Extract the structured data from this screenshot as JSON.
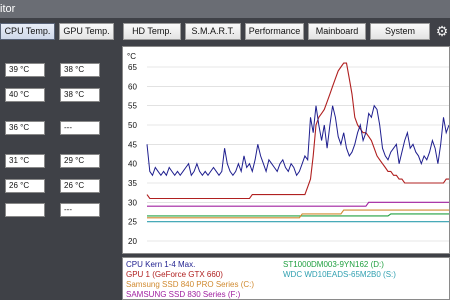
{
  "window": {
    "title": "itor"
  },
  "tabs": [
    {
      "label": "CPU Temp.",
      "active": true
    },
    {
      "label": "GPU Temp.",
      "active": false
    },
    {
      "label": "HD Temp.",
      "active": false
    },
    {
      "label": "S.M.A.R.T.",
      "active": false
    },
    {
      "label": "Performance",
      "active": false
    },
    {
      "label": "Mainboard",
      "active": false
    },
    {
      "label": "System",
      "active": false
    }
  ],
  "values": [
    [
      "39 °C",
      "38 °C"
    ],
    [
      "40 °C",
      "38 °C"
    ],
    [
      "36 °C",
      "---"
    ],
    [
      "31 °C",
      "29 °C"
    ],
    [
      "26 °C",
      "26 °C"
    ],
    [
      "",
      "---"
    ]
  ],
  "chart_data": {
    "type": "line",
    "ylabel": "°C",
    "ylim": [
      20,
      65
    ],
    "yticks": [
      "65",
      "60",
      "55",
      "50",
      "45",
      "40",
      "35",
      "30",
      "25",
      "20"
    ],
    "series": [
      {
        "name": "CPU Kern 1-4 Max.",
        "color": "#1f1f8f",
        "values": [
          45,
          38,
          37,
          39,
          38,
          37,
          38,
          37,
          39,
          38,
          37,
          38,
          37,
          38,
          39,
          40,
          37,
          38,
          40,
          38,
          37,
          38,
          37,
          38,
          39,
          38,
          37,
          38,
          44,
          40,
          38,
          37,
          38,
          40,
          38,
          42,
          39,
          40,
          38,
          41,
          45,
          42,
          40,
          38,
          41,
          40,
          39,
          38,
          40,
          41,
          39,
          38,
          40,
          39,
          37,
          38,
          40,
          42,
          41,
          52,
          48,
          55,
          50,
          46,
          50,
          44,
          50,
          55,
          52,
          47,
          45,
          48,
          44,
          42,
          43,
          45,
          48,
          50,
          46,
          48,
          53,
          52,
          55,
          54,
          50,
          44,
          42,
          41,
          43,
          44,
          45,
          40,
          43,
          46,
          48,
          44,
          45,
          43,
          42,
          40,
          42,
          41,
          43,
          46,
          44,
          40,
          45,
          52,
          48,
          50
        ]
      },
      {
        "name": "GPU 1 (GeForce GTX 660)",
        "color": "#b02020",
        "values": [
          32,
          31,
          31,
          31,
          31,
          31,
          31,
          31,
          31,
          31,
          31,
          31,
          31,
          31,
          31,
          31,
          31,
          31,
          31,
          31,
          31,
          31,
          31,
          31,
          31,
          31,
          31,
          31,
          31,
          31,
          31,
          31,
          31,
          31,
          31,
          31,
          31,
          31,
          32,
          32,
          32,
          32,
          32,
          32,
          32,
          32,
          32,
          32,
          32,
          32,
          32,
          32,
          32,
          32,
          32,
          32,
          32,
          32,
          34,
          36,
          42,
          50,
          52,
          53,
          54,
          56,
          58,
          60,
          62,
          64,
          65,
          66,
          66,
          62,
          58,
          52,
          50,
          49,
          48,
          48,
          47,
          46,
          44,
          42,
          41,
          40,
          39,
          38,
          38,
          37,
          37,
          36,
          36,
          35,
          35,
          35,
          35,
          35,
          35,
          35,
          35,
          35,
          35,
          35,
          35,
          35,
          35,
          35,
          36,
          36
        ]
      },
      {
        "name": "Samsung SSD 840 PRO Series (C:)",
        "color": "#d08a30",
        "values": [
          26,
          26,
          26,
          26,
          26,
          26,
          26,
          26,
          26,
          26,
          26,
          26,
          26,
          26,
          26,
          26,
          26,
          26,
          26,
          26,
          26,
          26,
          26,
          26,
          26,
          26,
          26,
          26,
          26,
          26,
          26,
          26,
          26,
          26,
          26,
          26,
          26,
          26,
          26,
          26,
          26,
          26,
          26,
          26,
          26,
          26,
          26,
          26,
          26,
          26,
          26,
          26,
          26,
          26,
          26,
          26,
          27,
          27,
          27,
          27,
          27,
          27,
          27,
          27,
          27,
          27,
          27,
          27,
          27,
          27,
          27,
          28,
          28,
          28,
          28,
          28,
          28,
          28,
          28,
          28,
          28,
          28,
          28,
          28,
          28,
          28,
          28,
          28,
          28,
          28,
          28,
          28,
          28,
          28,
          28,
          28,
          28,
          28,
          28,
          28,
          28,
          28,
          28,
          28,
          28,
          28,
          28,
          28,
          28,
          28
        ]
      },
      {
        "name": "SAMSUNG SSD 830 Series (F:)",
        "color": "#a020a0",
        "values": [
          29,
          29,
          29,
          29,
          29,
          29,
          29,
          29,
          29,
          29,
          29,
          29,
          29,
          29,
          29,
          29,
          29,
          29,
          29,
          29,
          29,
          29,
          29,
          29,
          29,
          29,
          29,
          29,
          29,
          29,
          29,
          29,
          29,
          29,
          29,
          29,
          29,
          29,
          29,
          29,
          29,
          29,
          29,
          29,
          29,
          29,
          29,
          29,
          29,
          29,
          29,
          29,
          29,
          29,
          29,
          29,
          29,
          29,
          29,
          29,
          29,
          29,
          29,
          29,
          29,
          29,
          29,
          29,
          29,
          29,
          29,
          29,
          29,
          29,
          29,
          29,
          29,
          29,
          29,
          29,
          30,
          30,
          30,
          30,
          30,
          30,
          30,
          30,
          30,
          30,
          30,
          30,
          30,
          30,
          30,
          30,
          30,
          30,
          30,
          30,
          30,
          30,
          30,
          30,
          30,
          30,
          30,
          30,
          30,
          30
        ]
      },
      {
        "name": "ST1000DM003-9YN162 (D:)",
        "color": "#20a040",
        "values": [
          26.5,
          26.5,
          26.5,
          26.5,
          26.5,
          26.5,
          26.5,
          26.5,
          26.5,
          26.5,
          26.5,
          26.5,
          26.5,
          26.5,
          26.5,
          26.5,
          26.5,
          26.5,
          26.5,
          26.5,
          26.5,
          26.5,
          26.5,
          26.5,
          26.5,
          26.5,
          26.5,
          26.5,
          26.5,
          26.5,
          26.5,
          26.5,
          26.5,
          26.5,
          26.5,
          26.5,
          26.5,
          26.5,
          26.5,
          26.5,
          26.5,
          26.5,
          26.5,
          26.5,
          26.5,
          26.5,
          26.5,
          26.5,
          26.5,
          26.5,
          26.5,
          26.5,
          26.5,
          26.5,
          26.5,
          26.5,
          26.5,
          26.5,
          26.5,
          26.5,
          26.5,
          26.5,
          26.5,
          26.5,
          26.5,
          26.5,
          26.5,
          26.5,
          26.5,
          26.5,
          26.5,
          26.5,
          26.5,
          26.5,
          26.5,
          26.5,
          26.5,
          26.5,
          26.5,
          26.5,
          26.5,
          26.5,
          26.5,
          26.5,
          26.5,
          26.5,
          26.5,
          26.5,
          27,
          27,
          27,
          27,
          27,
          27,
          27,
          27,
          27,
          27,
          27,
          27,
          27,
          27,
          27,
          27,
          27,
          27,
          27,
          27,
          27,
          27
        ]
      },
      {
        "name": "WDC WD10EADS-65M2B0 (S:)",
        "color": "#30a0b0",
        "values": [
          25,
          25,
          25,
          25,
          25,
          25,
          25,
          25,
          25,
          25,
          25,
          25,
          25,
          25,
          25,
          25,
          25,
          25,
          25,
          25,
          25,
          25,
          25,
          25,
          25,
          25,
          25,
          25,
          25,
          25,
          25,
          25,
          25,
          25,
          25,
          25,
          25,
          25,
          25,
          25,
          25,
          25,
          25,
          25,
          25,
          25,
          25,
          25,
          25,
          25,
          25,
          25,
          25,
          25,
          25,
          25,
          25,
          25,
          25,
          25,
          25,
          25,
          25,
          25,
          25,
          25,
          25,
          25,
          25,
          25,
          25,
          25,
          25,
          25,
          25,
          25,
          25,
          25,
          25,
          25,
          25,
          25,
          25,
          25,
          25,
          25,
          25,
          25,
          25,
          25,
          25,
          25,
          25,
          25,
          25,
          25,
          25,
          25,
          25,
          25,
          25,
          25,
          25,
          25,
          25,
          25,
          25,
          25,
          25,
          25
        ]
      }
    ]
  }
}
